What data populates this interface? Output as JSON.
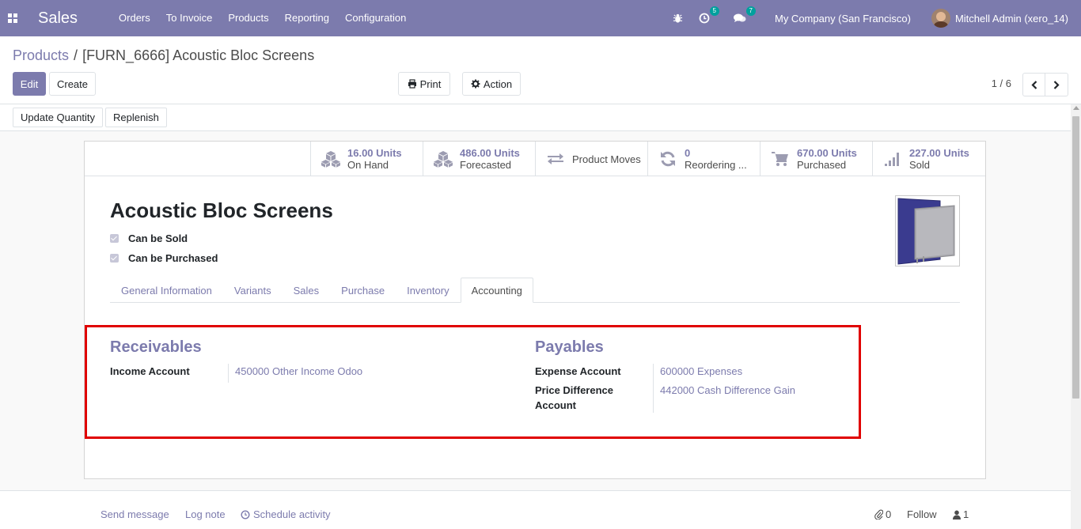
{
  "navbar": {
    "app_title": "Sales",
    "menu": [
      "Orders",
      "To Invoice",
      "Products",
      "Reporting",
      "Configuration"
    ],
    "activity_count": "5",
    "message_count": "7",
    "company": "My Company (San Francisco)",
    "user": "Mitchell Admin (xero_14)"
  },
  "breadcrumb": {
    "parent": "Products",
    "separator": "/",
    "current": "[FURN_6666] Acoustic Bloc Screens"
  },
  "buttons": {
    "edit": "Edit",
    "create": "Create",
    "print": "Print",
    "action": "Action",
    "update_quantity": "Update Quantity",
    "replenish": "Replenish"
  },
  "pager": {
    "value": "1 / 6"
  },
  "smart_buttons": [
    {
      "value": "16.00 Units",
      "label": "On Hand",
      "icon": "cubes-icon"
    },
    {
      "value": "486.00 Units",
      "label": "Forecasted",
      "icon": "cubes-icon"
    },
    {
      "value": "",
      "label": "Product Moves",
      "icon": "exchange-icon"
    },
    {
      "value": "0",
      "label": "Reordering ...",
      "icon": "refresh-icon"
    },
    {
      "value": "670.00 Units",
      "label": "Purchased",
      "icon": "cart-icon"
    },
    {
      "value": "227.00 Units",
      "label": "Sold",
      "icon": "signal-icon"
    }
  ],
  "product": {
    "name": "Acoustic Bloc Screens",
    "can_be_sold": "Can be Sold",
    "can_be_purchased": "Can be Purchased"
  },
  "tabs": [
    "General Information",
    "Variants",
    "Sales",
    "Purchase",
    "Inventory",
    "Accounting"
  ],
  "accounting": {
    "receivables": {
      "title": "Receivables",
      "income_label": "Income Account",
      "income_value": "450000 Other Income Odoo"
    },
    "payables": {
      "title": "Payables",
      "expense_label": "Expense Account",
      "expense_value": "600000 Expenses",
      "price_diff_label_1": "Price Difference",
      "price_diff_label_2": "Account",
      "price_diff_value": "442000 Cash Difference Gain"
    }
  },
  "chatter": {
    "send_message": "Send message",
    "log_note": "Log note",
    "schedule_activity": "Schedule activity",
    "attachments": "0",
    "follow": "Follow",
    "followers": "1"
  },
  "colors": {
    "brand": "#7c7bad",
    "highlight": "#e00000"
  }
}
